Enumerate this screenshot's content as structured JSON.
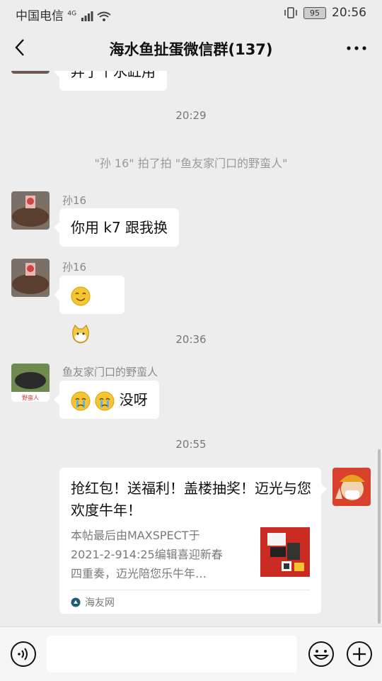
{
  "status": {
    "carrier": "中国电信",
    "network": "4G",
    "battery": "95",
    "time": "20:56"
  },
  "nav": {
    "title": "海水鱼扯蛋微信群(137)"
  },
  "messages": {
    "partial_text": "弄了个水缸用",
    "time1": "20:29",
    "system": "\"孙 16\" 拍了拍 \"鱼友家门口的野蛮人\"",
    "m1_name": "孙16",
    "m1_text": "你用 k7 跟我换",
    "m2_name": "孙16",
    "time2": "20:36",
    "m3_name": "鱼友家门口的野蛮人",
    "m3_text": "没呀",
    "time3": "20:55"
  },
  "card": {
    "title": "抢红包！送福利！盖楼抽奖！迈光与您欢度牛年！",
    "desc_line1": "本帖最后由MAXSPECT于",
    "desc_line2": "2021-2-914:25编辑喜迎新春",
    "desc_line3": "四重奏，迈光陪您乐牛年…",
    "source": "海友网"
  },
  "icons": [
    "back-icon",
    "more-icon",
    "voice-icon",
    "emoji-icon",
    "plus-icon",
    "signal-icon",
    "wifi-icon",
    "vibrate-icon",
    "battery-icon"
  ]
}
